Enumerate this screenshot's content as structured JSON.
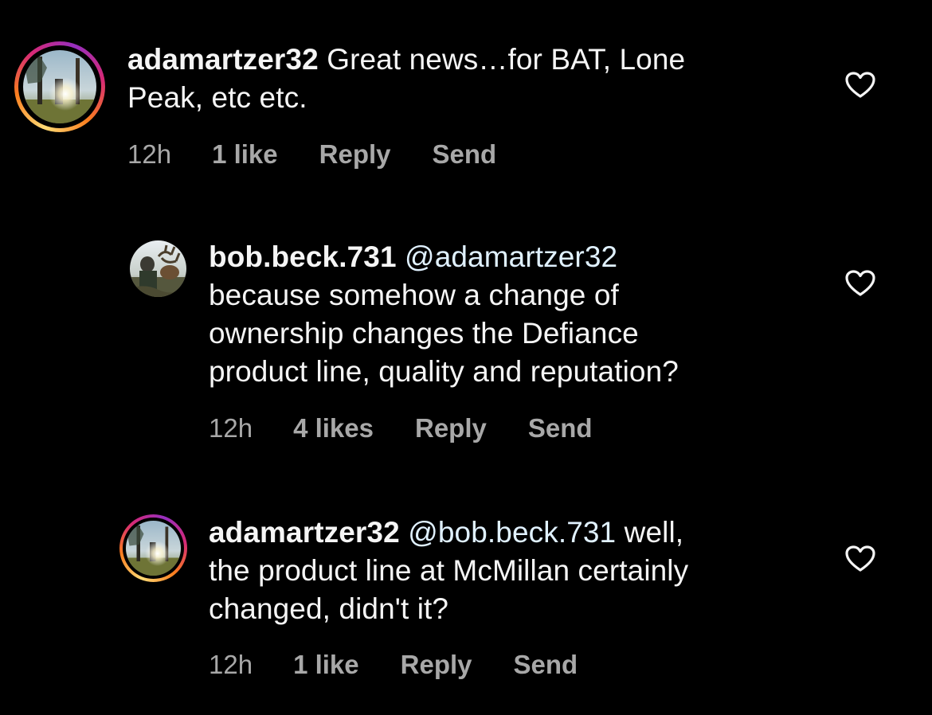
{
  "comments": [
    {
      "username": "adamartzer32",
      "mention": "",
      "text": "Great news…for BAT, Lone",
      "text_line2": "Peak, etc etc.",
      "time": "12h",
      "likes": "1 like",
      "reply": "Reply",
      "send": "Send"
    },
    {
      "username": "bob.beck.731",
      "mention": "@adamartzer32",
      "line1": "because somehow a change of",
      "line2": "ownership changes the Defiance",
      "line3": "product line, quality and reputation?",
      "time": "12h",
      "likes": "4 likes",
      "reply": "Reply",
      "send": "Send"
    },
    {
      "username": "adamartzer32",
      "mention": "@bob.beck.731",
      "line1_tail": "well,",
      "line2": "the product line at McMillan certainly",
      "line3": "changed, didn't it?",
      "time": "12h",
      "likes": "1 like",
      "reply": "Reply",
      "send": "Send"
    }
  ],
  "colors": {
    "background": "#000000",
    "text": "#f5f5f5",
    "meta": "#a8a8a8",
    "mention": "#e0f1ff"
  },
  "icons": {
    "like": "heart-outline-icon",
    "avatar_story_ring": "story-ring"
  }
}
